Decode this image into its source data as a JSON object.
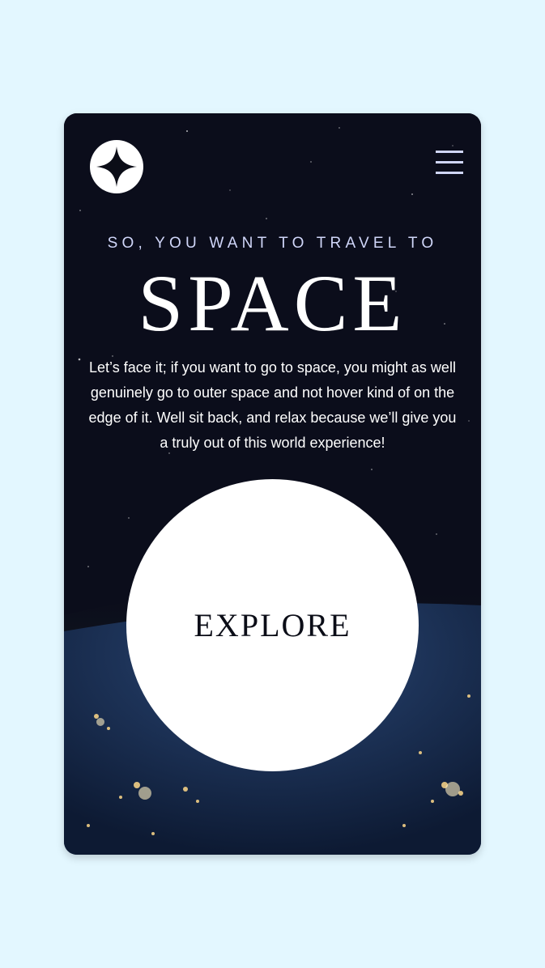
{
  "header": {
    "logo_icon": "four-point-star-icon",
    "menu_icon": "hamburger-menu-icon"
  },
  "hero": {
    "tagline": "SO, YOU WANT TO TRAVEL TO",
    "headline": "SPACE",
    "description": "Let’s face it; if you want to go to space, you might as well genuinely go to outer space and not hover kind of on the edge of it. Well sit back, and relax because we’ll give you a truly out of this world experience!",
    "cta_label": "EXPLORE"
  },
  "colors": {
    "page_background": "#e3f7ff",
    "card_background": "#0b0d1b",
    "accent_text": "#d0d6f9",
    "white": "#ffffff"
  }
}
